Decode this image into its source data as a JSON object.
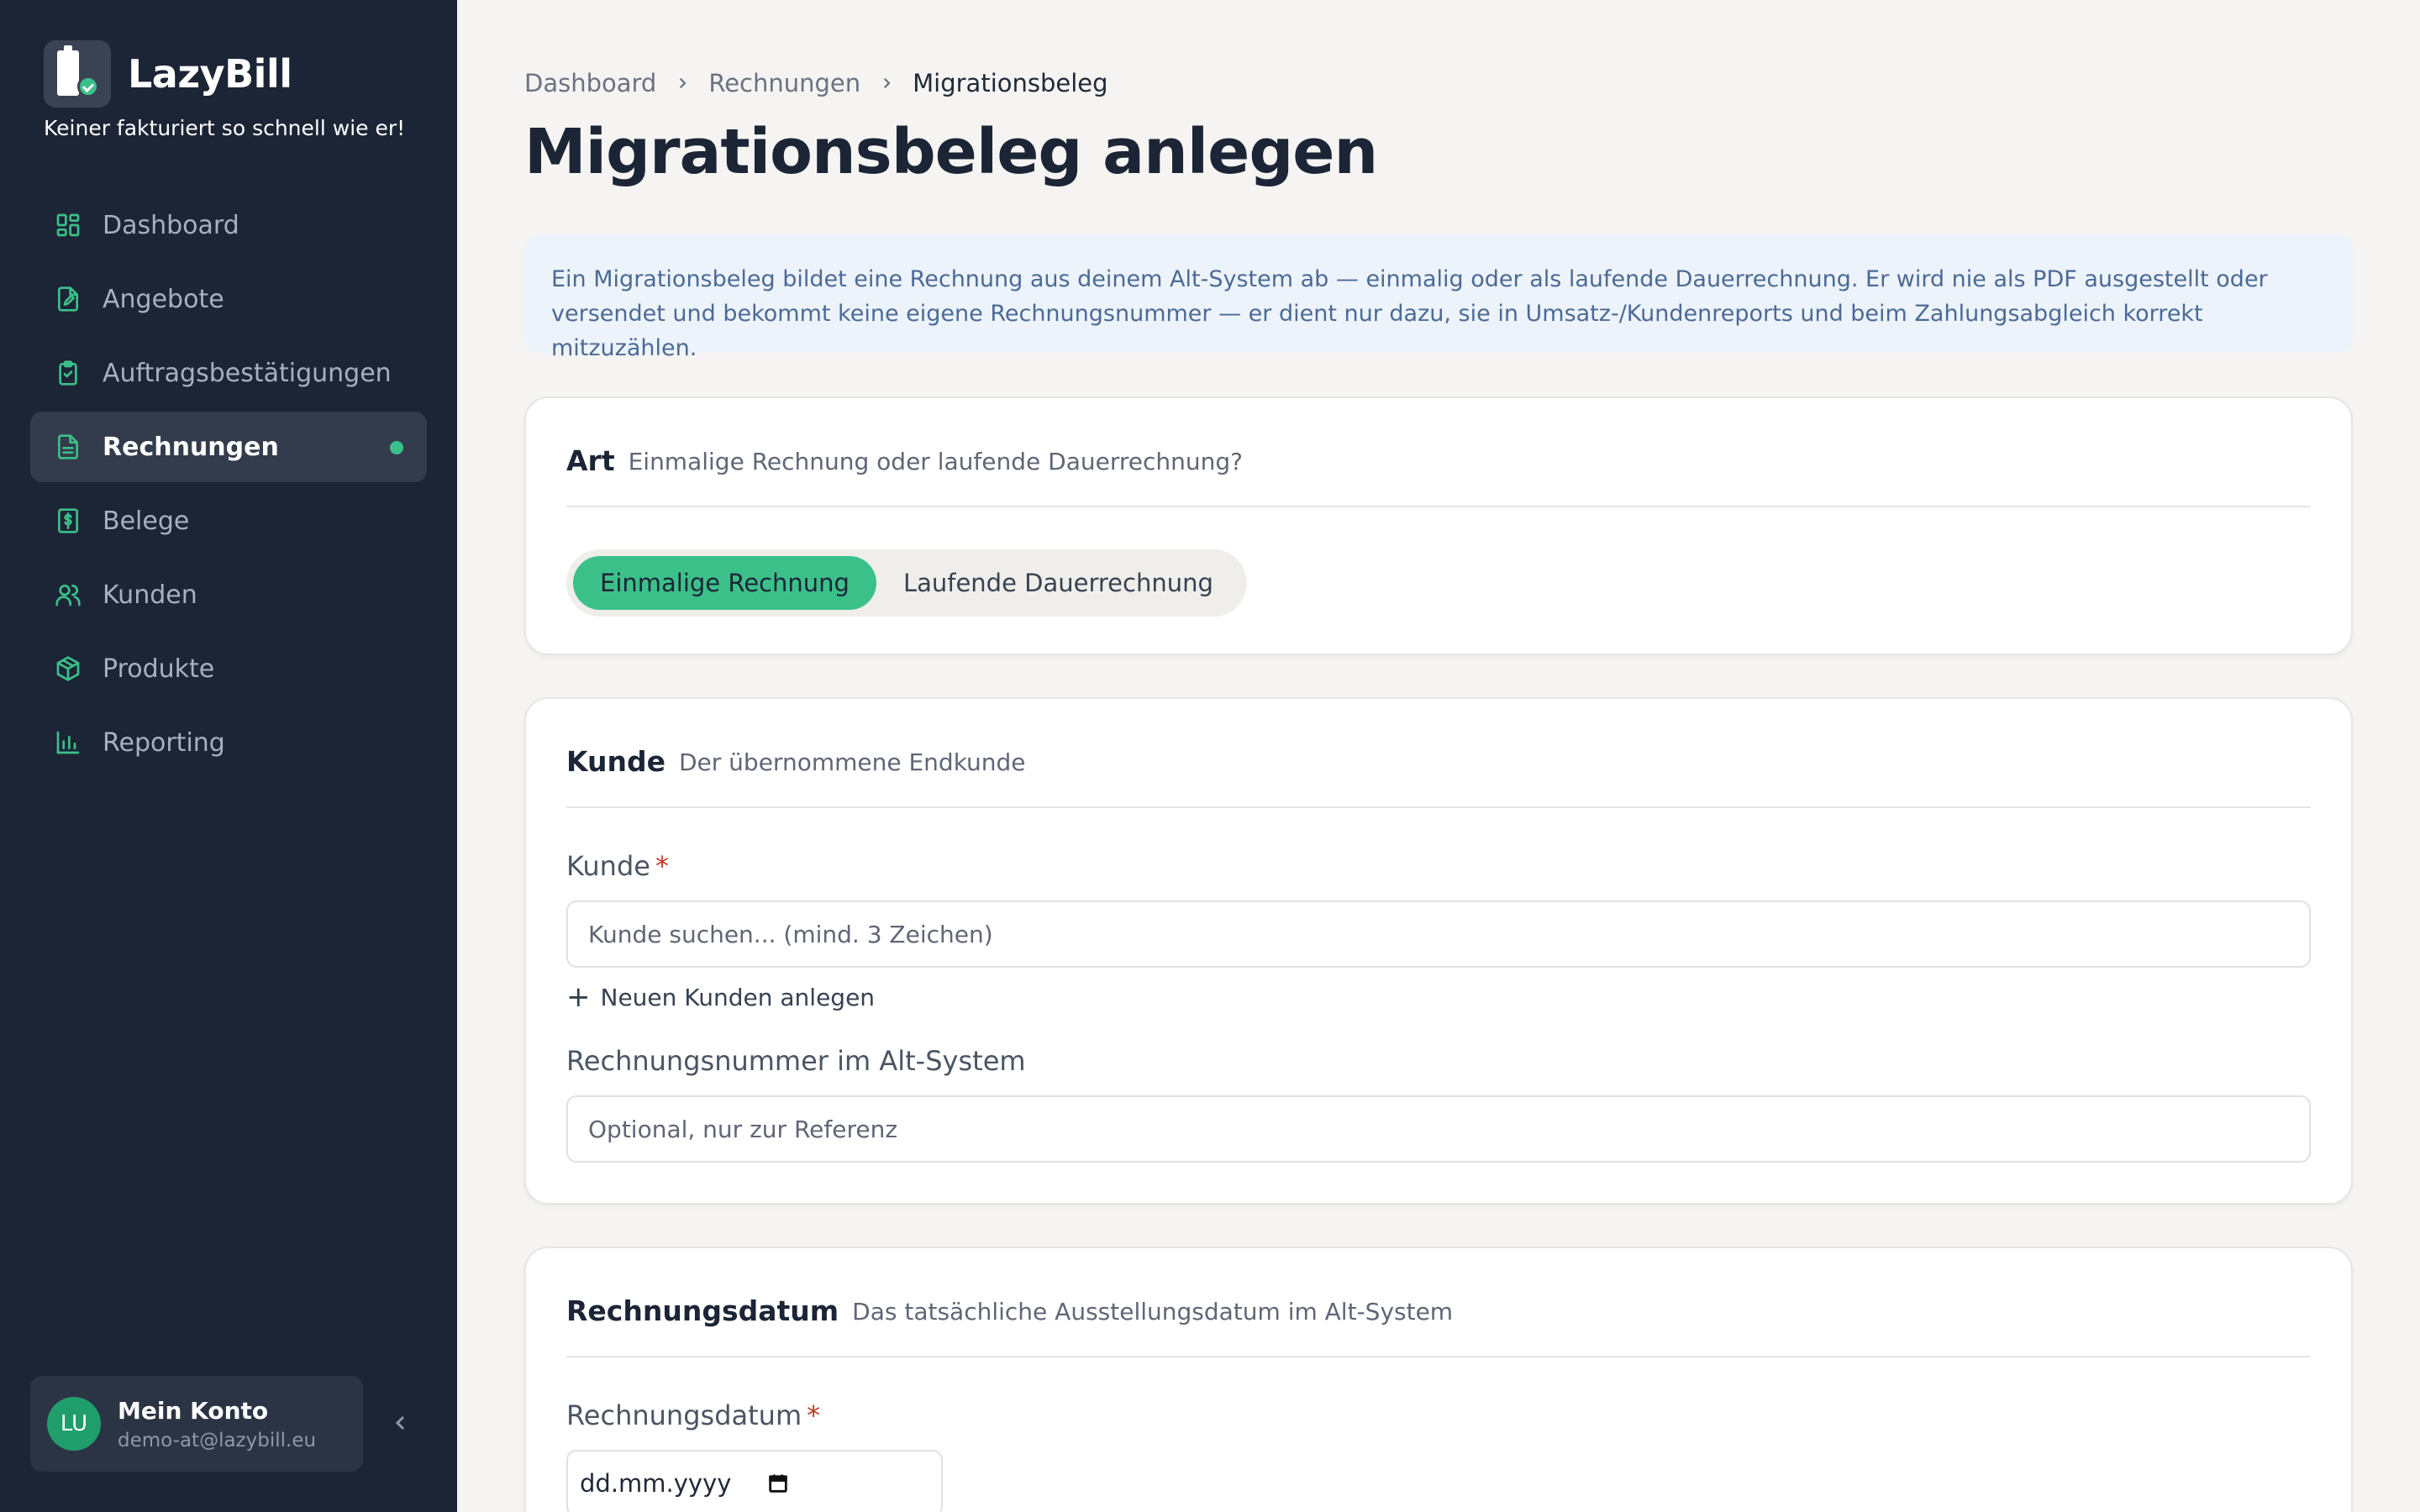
{
  "brand": {
    "name": "LazyBill",
    "tagline": "Keiner fakturiert so schnell wie er!"
  },
  "nav": [
    {
      "label": "Dashboard",
      "icon": "dashboard-icon"
    },
    {
      "label": "Angebote",
      "icon": "document-edit-icon"
    },
    {
      "label": "Auftragsbestätigungen",
      "icon": "clipboard-check-icon"
    },
    {
      "label": "Rechnungen",
      "icon": "document-icon",
      "active": true
    },
    {
      "label": "Belege",
      "icon": "receipt-icon"
    },
    {
      "label": "Kunden",
      "icon": "users-icon"
    },
    {
      "label": "Produkte",
      "icon": "package-icon"
    },
    {
      "label": "Reporting",
      "icon": "bar-chart-icon"
    }
  ],
  "account": {
    "initials": "LU",
    "name": "Mein Konto",
    "email": "demo-at@lazybill.eu"
  },
  "breadcrumb": {
    "items": [
      "Dashboard",
      "Rechnungen"
    ],
    "current": "Migrationsbeleg"
  },
  "page": {
    "title": "Migrationsbeleg anlegen"
  },
  "info": {
    "text": "Ein Migrationsbeleg bildet eine Rechnung aus deinem Alt-System ab — einmalig oder als laufende Dauerrechnung. Er wird nie als PDF ausgestellt oder versendet und bekommt keine eigene Rechnungsnummer — er dient nur dazu, sie in Umsatz-/Kundenreports und beim Zahlungsabgleich korrekt mitzuzählen."
  },
  "art": {
    "title": "Art",
    "subtitle": "Einmalige Rechnung oder laufende Dauerrechnung?",
    "options": [
      "Einmalige Rechnung",
      "Laufende Dauerrechnung"
    ],
    "selected": "Einmalige Rechnung"
  },
  "kunde": {
    "title": "Kunde",
    "subtitle": "Der übernommene Endkunde",
    "field_label": "Kunde",
    "required_mark": "*",
    "search_placeholder": "Kunde suchen... (mind. 3 Zeichen)",
    "add_link": "Neuen Kunden anlegen",
    "altnr_label": "Rechnungsnummer im Alt-System",
    "altnr_placeholder": "Optional, nur zur Referenz"
  },
  "datum": {
    "title": "Rechnungsdatum",
    "subtitle": "Das tatsächliche Ausstellungsdatum im Alt-System",
    "field_label": "Rechnungsdatum",
    "required_mark": "*",
    "date_placeholder": "dd.mm.yyyy"
  },
  "colors": {
    "sidebar": "#1c2536",
    "accent": "#3cc08a",
    "background": "#f5f4f2"
  }
}
